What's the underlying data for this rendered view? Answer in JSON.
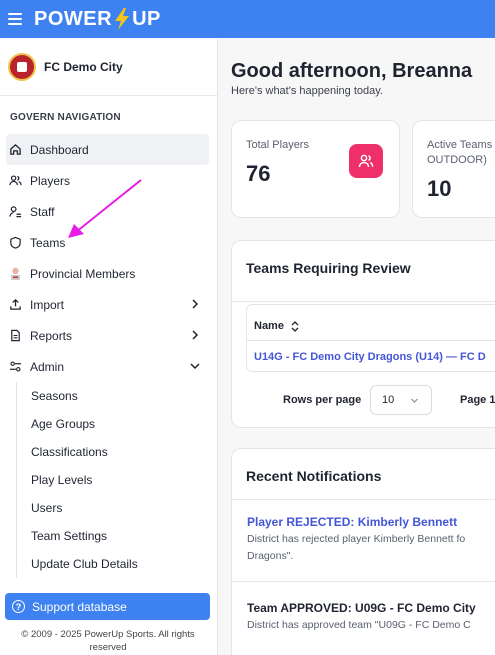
{
  "brand": {
    "logo_left": "POWER",
    "logo_right": "UP"
  },
  "club": {
    "name": "FC Demo City"
  },
  "sidebar": {
    "heading": "GOVERN NAVIGATION",
    "items": [
      {
        "label": "Dashboard",
        "icon": "home-icon"
      },
      {
        "label": "Players",
        "icon": "users-icon"
      },
      {
        "label": "Staff",
        "icon": "staff-icon"
      },
      {
        "label": "Teams",
        "icon": "shield-icon"
      },
      {
        "label": "Provincial Members",
        "icon": "provincial-badge-icon"
      },
      {
        "label": "Import",
        "icon": "upload-icon"
      },
      {
        "label": "Reports",
        "icon": "document-icon"
      },
      {
        "label": "Admin",
        "icon": "settings-sliders-icon"
      }
    ],
    "admin_submenu": [
      "Seasons",
      "Age Groups",
      "Classifications",
      "Play Levels",
      "Users",
      "Team Settings",
      "Update Club Details"
    ],
    "support_label": "Support database",
    "copyright": "© 2009 - 2025 PowerUp Sports. All rights reserved"
  },
  "main": {
    "greeting": "Good afternoon, Breanna",
    "subtitle": "Here's what's happening today.",
    "stats": [
      {
        "label": "Total Players",
        "value": "76"
      },
      {
        "label_line1": "Active Teams",
        "label_line2": "OUTDOOR)",
        "value": "10"
      }
    ],
    "review": {
      "title": "Teams Requiring Review",
      "column_name": "Name",
      "row_link": "U14G - FC Demo City Dragons (U14) — FC D",
      "rows_per_page_label": "Rows per page",
      "rows_per_page_value": "10",
      "page_text": "Page 1"
    },
    "notifications": {
      "title": "Recent Notifications",
      "items": [
        {
          "title": "Player REJECTED: Kimberly Bennett",
          "body": "District has rejected player Kimberly Bennett fo Dragons\"."
        },
        {
          "title": "Team APPROVED: U09G - FC Demo City",
          "body": "District has approved team \"U09G - FC Demo C"
        }
      ]
    }
  },
  "colors": {
    "brand_blue": "#3d82f0",
    "accent_pink": "#ee2f68",
    "link_blue": "#4456d8",
    "annotation_magenta": "#e81ce8"
  }
}
